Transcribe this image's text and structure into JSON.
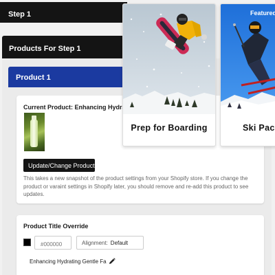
{
  "steps": {
    "step_label": "Step 1",
    "products_label": "Products For Step 1",
    "product_label": "Product 1"
  },
  "current_product": {
    "label": "Current Product: Enhancing Hydrating Gentle Face Wash",
    "update_button": "Update/Change Product",
    "help_text": "This takes a new snapshot of the product settings from your Shopify store. If you change the product or varaint settings in Shopify later, you should remove and re-add this product to see updates."
  },
  "title_override": {
    "heading": "Product Title Override",
    "color_value": "",
    "color_placeholder": "#000000",
    "alignment_label": "Alignment:",
    "alignment_value": "Default",
    "title_text": "Enhancing Hydrating Gentle Fa"
  },
  "collections": [
    {
      "title": "Prep for Boarding",
      "badge": ""
    },
    {
      "title": "Ski Pack",
      "badge": "Featured"
    }
  ],
  "colors": {
    "dark_bar": "#141414",
    "product_bar": "#1b3aa0",
    "swatch": "#000000"
  }
}
